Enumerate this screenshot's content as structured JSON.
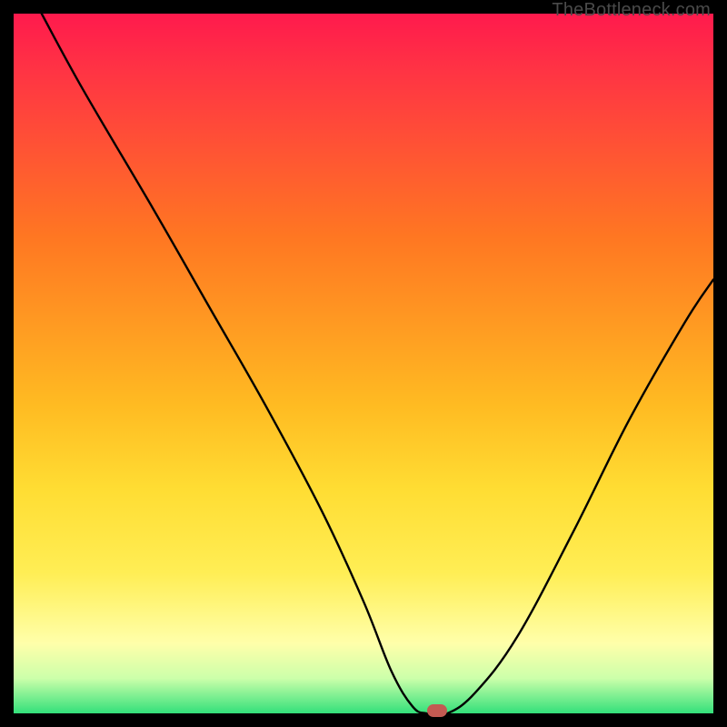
{
  "watermark": "TheBottleneck.com",
  "chart_data": {
    "type": "line",
    "title": "",
    "xlabel": "",
    "ylabel": "",
    "xlim": [
      0,
      100
    ],
    "ylim": [
      0,
      100
    ],
    "grid": false,
    "legend": false,
    "series": [
      {
        "name": "bottleneck-curve",
        "x": [
          4,
          10,
          20,
          28,
          36,
          44,
          50,
          54,
          57,
          59,
          62,
          66,
          72,
          80,
          88,
          96,
          100
        ],
        "y": [
          100,
          89,
          72,
          58,
          44,
          29,
          16,
          6,
          1,
          0,
          0,
          3,
          11,
          26,
          42,
          56,
          62
        ]
      }
    ],
    "marker": {
      "x": 60.5,
      "y": 0
    },
    "colors": {
      "curve": "#000000",
      "marker": "#c35a52",
      "gradient_top": "#ff1a4d",
      "gradient_bottom": "#33e07a",
      "frame": "#000000"
    }
  }
}
